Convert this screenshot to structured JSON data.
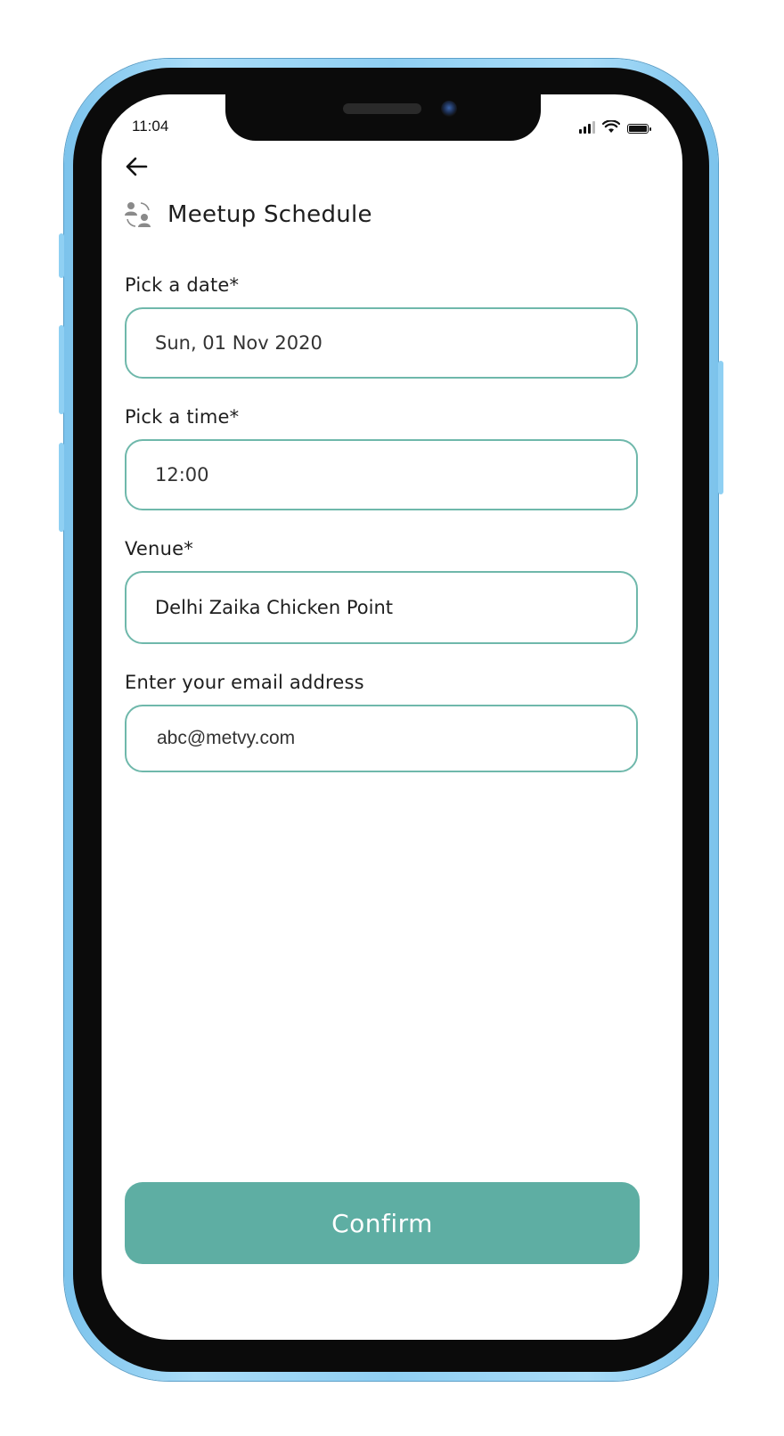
{
  "status_bar": {
    "time": "11:04"
  },
  "header": {
    "title": "Meetup Schedule",
    "icon": "people-swap-icon"
  },
  "form": {
    "date": {
      "label": "Pick a date*",
      "value": "Sun, 01 Nov 2020"
    },
    "time": {
      "label": "Pick a time*",
      "value": "12:00"
    },
    "venue": {
      "label": "Venue*",
      "value": "Delhi Zaika Chicken Point"
    },
    "email": {
      "label": "Enter your email address",
      "value": "abc@metvy.com"
    }
  },
  "actions": {
    "confirm_label": "Confirm"
  },
  "colors": {
    "accent": "#5eaea3",
    "field_border": "#6fb8ab",
    "device_frame": "#8fcff3"
  }
}
